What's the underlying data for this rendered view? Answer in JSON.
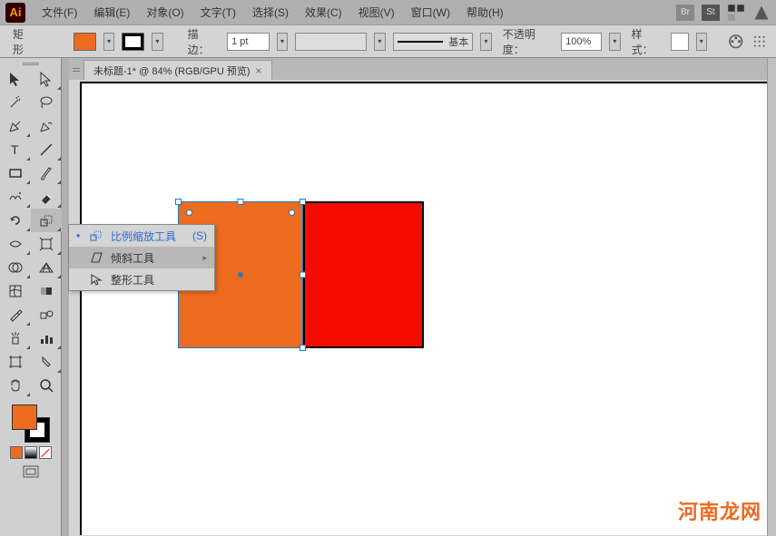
{
  "app": {
    "logo_text": "Ai"
  },
  "menu": {
    "file": "文件(F)",
    "edit": "编辑(E)",
    "object": "对象(O)",
    "text": "文字(T)",
    "select": "选择(S)",
    "effect": "效果(C)",
    "view": "视图(V)",
    "window": "窗口(W)",
    "help": "帮助(H)"
  },
  "controlbar": {
    "shape_label": "矩形",
    "stroke_label": "描边：",
    "stroke_weight": "1 pt",
    "profile_label": "基本",
    "opacity_label": "不透明度：",
    "opacity_value": "100%",
    "style_label": "样式："
  },
  "tab": {
    "title": "未标题-1* @ 84% (RGB/GPU 预览)"
  },
  "context_menu": {
    "scale": "比例缩放工具",
    "scale_key": "(S)",
    "shear": "倾斜工具",
    "reshape": "整形工具"
  },
  "colors": {
    "fill": "#ed6b1f",
    "stroke": "#000000",
    "shape_orange": "#ed6b1f",
    "shape_red": "#f60b00",
    "selection": "#1b7ac4"
  },
  "canvas": {
    "zoom": "84%",
    "color_mode": "RGB/GPU 预览"
  },
  "watermark": "河南龙网"
}
